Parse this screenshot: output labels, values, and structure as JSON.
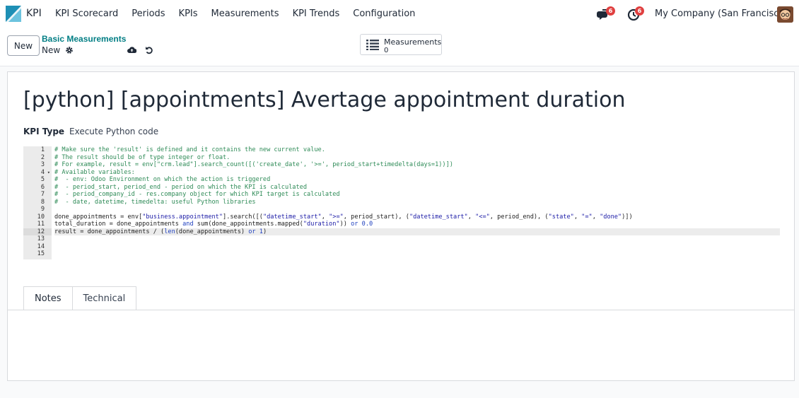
{
  "navbar": {
    "app_name": "KPI",
    "menu": [
      "KPI Scorecard",
      "Periods",
      "KPIs",
      "Measurements",
      "KPI Trends",
      "Configuration"
    ],
    "chat_badge": "6",
    "activity_badge": "6",
    "company": "My Company (San Francisco)"
  },
  "control": {
    "new_label": "New",
    "breadcrumb": "Basic Measurements",
    "record_name": "New",
    "stat_label": "Measurements",
    "stat_value": "0"
  },
  "form": {
    "title": "[python] [appointments] Avertage appointment duration",
    "kpi_type_label": "KPI Type",
    "kpi_type_value": "Execute Python code"
  },
  "code": {
    "line_numbers": [
      "1",
      "2",
      "3",
      "4",
      "5",
      "6",
      "7",
      "8",
      "9",
      "10",
      "11",
      "12",
      "13",
      "14",
      "15"
    ],
    "active_line": 12
  },
  "tabs": [
    "Notes",
    "Technical"
  ],
  "colors": {
    "accent": "#017e84",
    "badge": "#e04040"
  }
}
